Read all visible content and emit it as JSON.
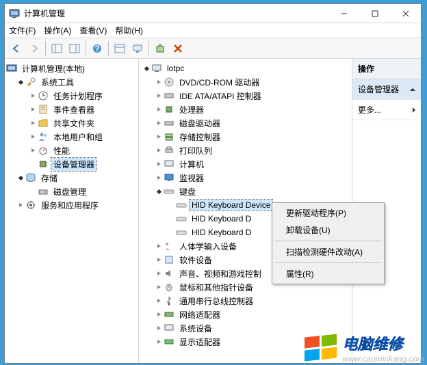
{
  "window": {
    "title": "计算机管理"
  },
  "menu": {
    "file": "文件(F)",
    "action": "操作(A)",
    "view": "查看(V)",
    "help": "帮助(H)"
  },
  "left_tree": {
    "root": "计算机管理(本地)",
    "system_tools": "系统工具",
    "task_scheduler": "任务计划程序",
    "event_viewer": "事件查看器",
    "shared_folders": "共享文件夹",
    "local_users": "本地用户和组",
    "performance": "性能",
    "device_manager": "设备管理器",
    "storage": "存储",
    "disk_management": "磁盘管理",
    "services_apps": "服务和应用程序"
  },
  "mid_tree": {
    "root": "lotpc",
    "dvd": "DVD/CD-ROM 驱动器",
    "ide": "IDE ATA/ATAPI 控制器",
    "cpu": "处理器",
    "disk_drives": "磁盘驱动器",
    "storage_ctrl": "存储控制器",
    "print_queue": "打印队列",
    "computer": "计算机",
    "monitor": "监视器",
    "keyboard": "键盘",
    "hid_kb1": "HID Keyboard Device",
    "hid_kb2": "HID Keyboard D",
    "hid_kb3": "HID Keyboard D",
    "hid_input": "人体学输入设备",
    "software_dev": "软件设备",
    "sound": "声音、视频和游戏控制",
    "mouse": "鼠标和其他指针设备",
    "usb": "通用串行总线控制器",
    "network": "网络适配器",
    "system_dev": "系统设备",
    "display": "显示适配器"
  },
  "right_panel": {
    "header": "操作",
    "device_manager": "设备管理器",
    "more": "更多..."
  },
  "context_menu": {
    "update_driver": "更新驱动程序(P)",
    "uninstall": "卸载设备(U)",
    "scan_hardware": "扫描检测硬件改动(A)",
    "properties": "属性(R)"
  },
  "watermark": {
    "title": "电脑维修",
    "url": "www.caominkang.com"
  }
}
